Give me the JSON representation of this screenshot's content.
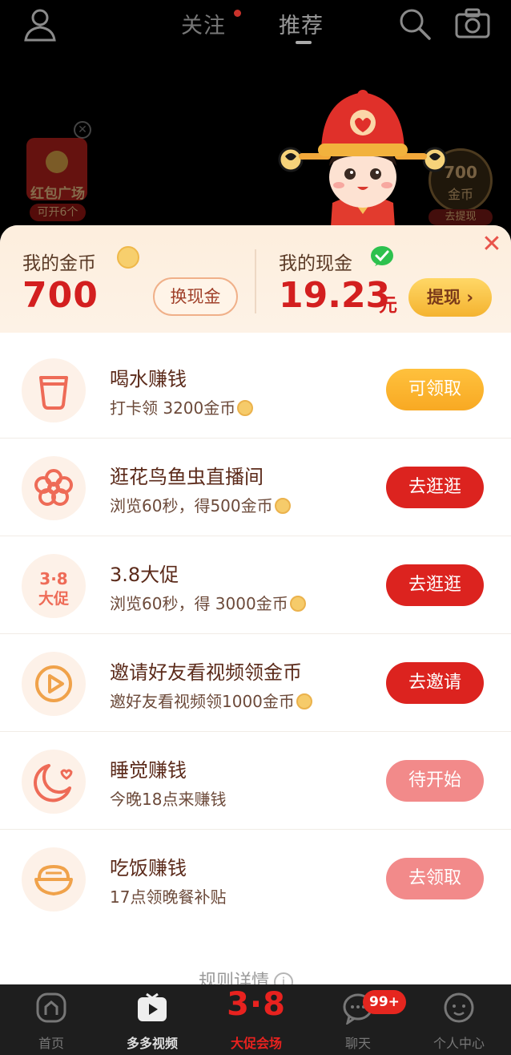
{
  "top": {
    "tabs": [
      {
        "label": "关注",
        "has_dot": true
      },
      {
        "label": "推荐",
        "active": true
      }
    ],
    "icons": [
      "user-icon",
      "search-icon",
      "camera-icon"
    ]
  },
  "side": {
    "redpack": {
      "title": "红包广场",
      "subtitle": "可开6个"
    },
    "coin_badge": {
      "value": "700",
      "unit": "金币",
      "action": "去提现"
    }
  },
  "wallet": {
    "coin_label": "我的金币",
    "coin_value": "700",
    "exchange_label": "换现金",
    "cash_label": "我的现金",
    "cash_value": "19.23",
    "cash_unit": "元",
    "withdraw_label": "提现 ›"
  },
  "tasks": [
    {
      "icon": "cup-icon",
      "title": "喝水赚钱",
      "desc_prefix": "打卡领 3200金币",
      "has_coin": true,
      "button": "可领取",
      "button_style": "yellow"
    },
    {
      "icon": "flower-icon",
      "title": "逛花鸟鱼虫直播间",
      "desc_prefix": "浏览60秒，得500金币",
      "has_coin": true,
      "button": "去逛逛",
      "button_style": "red"
    },
    {
      "icon": "promo-38-icon",
      "icon_text_top": "3·8",
      "icon_text_bottom": "大促",
      "title": "3.8大促",
      "desc_prefix": "浏览60秒，得 3000金币",
      "has_coin": true,
      "button": "去逛逛",
      "button_style": "red"
    },
    {
      "icon": "play-icon",
      "title": "邀请好友看视频领金币",
      "desc_prefix": "邀好友看视频领1000金币",
      "has_coin": true,
      "button": "去邀请",
      "button_style": "red"
    },
    {
      "icon": "moon-icon",
      "title": "睡觉赚钱",
      "desc_prefix": "今晚18点来赚钱",
      "has_coin": false,
      "button": "待开始",
      "button_style": "pink"
    },
    {
      "icon": "bowl-icon",
      "title": "吃饭赚钱",
      "desc_prefix": "17点领晚餐补贴",
      "has_coin": false,
      "button": "去领取",
      "button_style": "pink"
    }
  ],
  "rules_label": "规则详情",
  "rules_icon_glyph": "i",
  "nav": {
    "home": "首页",
    "video": "多多视频",
    "promo_big": "3·8",
    "promo": "大促会场",
    "chat": "聊天",
    "chat_badge": "99+",
    "profile": "个人中心"
  },
  "colors": {
    "accent_red": "#dc231f",
    "gold": "#f8a923",
    "pink": "#f28a8a",
    "text_brown": "#5b2a1a"
  }
}
